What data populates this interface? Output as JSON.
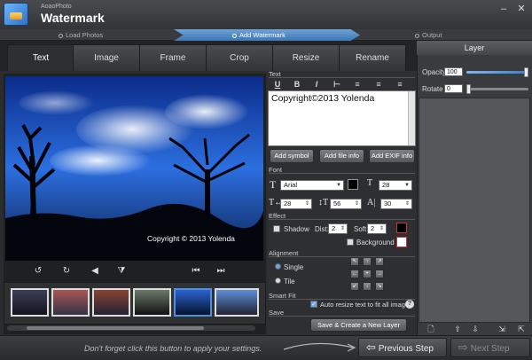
{
  "app": {
    "brand": "AoaoPhoto",
    "title": "Watermark"
  },
  "window": {
    "minimize": "–",
    "close": "✕"
  },
  "steps": [
    {
      "label": "Load Photos",
      "active": false
    },
    {
      "label": "Add Watermark",
      "active": true
    },
    {
      "label": "Output",
      "active": false
    }
  ],
  "tabs": [
    "Text",
    "Image",
    "Frame",
    "Crop",
    "Resize",
    "Rename"
  ],
  "active_tab": "Text",
  "preview": {
    "watermark_text": "Copyright © 2013 Yolenda"
  },
  "text_section": {
    "header": "Text",
    "format_buttons": [
      "U",
      "B",
      "I",
      "⊢",
      "≡",
      "≡",
      "≡"
    ],
    "content": "Copyright©2013 Yolenda",
    "add_symbol": "Add symbol",
    "add_file_info": "Add file info",
    "add_exif_info": "Add EXIF info"
  },
  "font_section": {
    "header": "Font",
    "family": "Arial",
    "size": "28",
    "width": "28",
    "height": "56",
    "spacing": "30",
    "color": "#000000"
  },
  "effect_section": {
    "header": "Effect",
    "shadow_label": "Shadow",
    "dist_label": "Dist:",
    "dist_value": "2",
    "soft_label": "Soft:",
    "soft_value": "2",
    "background_label": "Background"
  },
  "alignment_section": {
    "header": "Alignment",
    "single_label": "Single",
    "tile_label": "Tile",
    "arrows": [
      "↖",
      "↑",
      "↗",
      "←",
      "•",
      "→",
      "↙",
      "↓",
      "↘"
    ]
  },
  "smart_fit_section": {
    "header": "Smart Fit",
    "auto_resize_label": "Auto resize text to fit all images",
    "auto_resize_checked": true,
    "help": "?"
  },
  "save_section": {
    "header": "Save",
    "save_button": "Save & Create a New Layer"
  },
  "layer_panel": {
    "title": "Layer",
    "opacity_label": "Opacity",
    "opacity_value": "100",
    "opacity_fraction": 1.0,
    "rotate_label": "Rotate",
    "rotate_value": "0",
    "rotate_fraction": 0.0
  },
  "bottom": {
    "hint": "Don't forget click this button to apply your settings.",
    "previous": "Previous Step",
    "next": "Next Step"
  },
  "colors": {
    "accent": "#4f8fe0",
    "active_step": "#5a93d2"
  }
}
